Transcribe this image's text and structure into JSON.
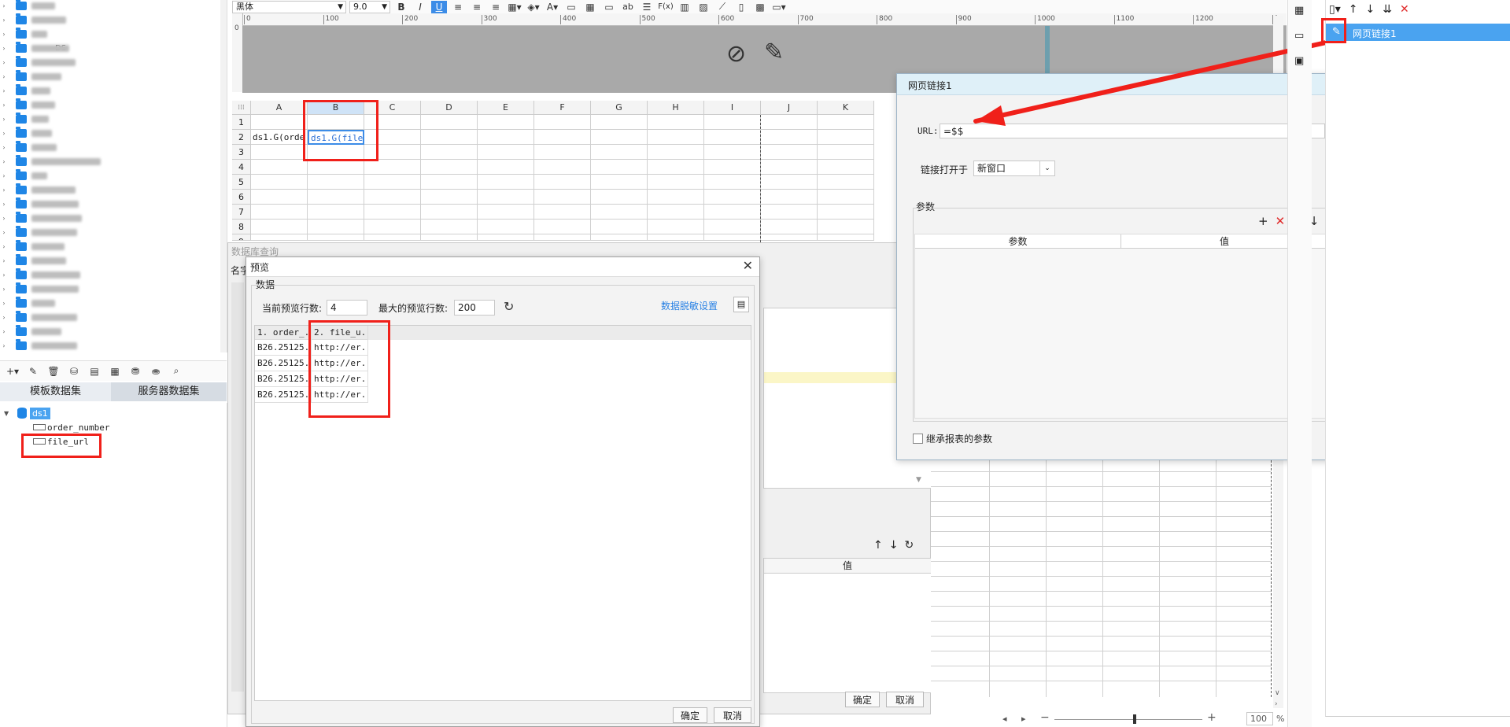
{
  "toolbar": {
    "font_family": "黑体",
    "font_size": "9.0",
    "bold": "B",
    "italic": "I",
    "underline": "U",
    "text_icon": "ab",
    "formula_icon": "F(x)"
  },
  "ruler": {
    "marks": [
      "0",
      "100",
      "200",
      "300",
      "400",
      "500",
      "600",
      "700",
      "800",
      "900",
      "1000",
      "1100",
      "1200",
      "1"
    ]
  },
  "sheet": {
    "columns": [
      "A",
      "B",
      "C",
      "D",
      "E",
      "F",
      "G",
      "H",
      "I",
      "J",
      "K"
    ],
    "rows": [
      "1",
      "2",
      "3",
      "4",
      "5",
      "6",
      "7",
      "8",
      "9"
    ],
    "cell_a2": "ds1.G(orde",
    "cell_b2": "ds1.G(file_"
  },
  "left_panel": {
    "tab_template": "模板数据集",
    "tab_server": "服务器数据集",
    "dataset_name": "ds1",
    "fields": [
      "order_number",
      "file_url"
    ],
    "blurred_label": "DS"
  },
  "db_query_dialog": {
    "title": "数据库查询",
    "name_label": "名字",
    "param_header_value": "值",
    "confirm": "确定",
    "cancel": "取消"
  },
  "preview_dialog": {
    "title": "预览",
    "group_label": "数据",
    "current_rows_label": "当前预览行数:",
    "current_rows_value": "4",
    "max_rows_label": "最大的预览行数:",
    "max_rows_value": "200",
    "desensitize_link": "数据脱敏设置",
    "columns": [
      "1. order_...",
      "2. file_u..."
    ],
    "rows": [
      [
        "B26.25125...",
        "http://er..."
      ],
      [
        "B26.25125...",
        "http://er..."
      ],
      [
        "B26.25125...",
        "http://er..."
      ],
      [
        "B26.25125...",
        "http://er..."
      ]
    ],
    "confirm": "确定",
    "cancel": "取消"
  },
  "hyperlink_dialog": {
    "title": "网页链接1",
    "url_label": "URL:",
    "url_value": "=$$",
    "open_in_label": "链接打开于",
    "open_in_value": "新窗口",
    "params_group": "参数",
    "param_col": "参数",
    "value_col": "值",
    "inherit_label": "继承报表的参数"
  },
  "right_panel": {
    "selected_item": "网页链接1"
  },
  "status_bar": {
    "zoom_value": "100",
    "zoom_unit": "%"
  },
  "colors": {
    "accent": "#1f86e6",
    "highlight": "#f0201a",
    "selected_bg": "#4aa3f0"
  }
}
